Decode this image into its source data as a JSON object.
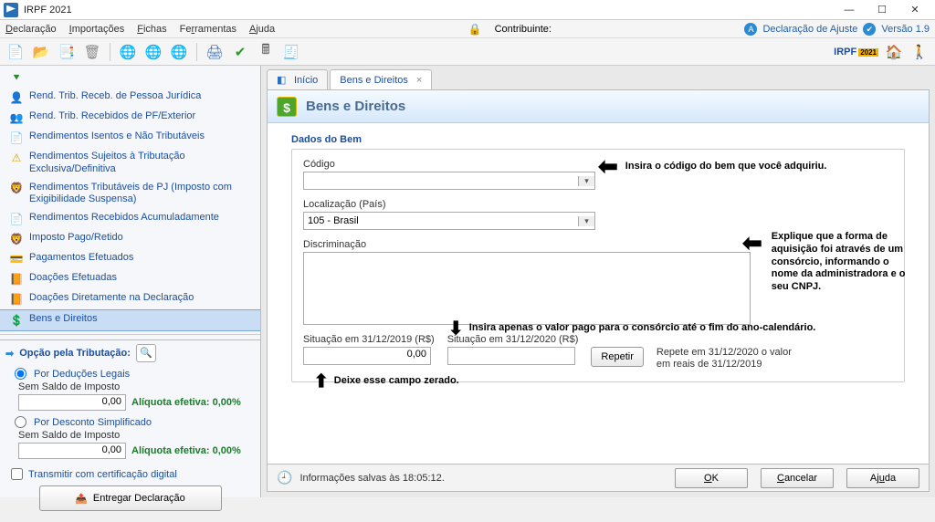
{
  "title": "IRPF 2021",
  "menu": {
    "items": [
      "Declaração",
      "Importações",
      "Fichas",
      "Ferramentas",
      "Ajuda"
    ],
    "contribuinte_label": "Contribuinte:",
    "decl_ajuste": "Declaração de Ajuste",
    "versao": "Versão 1.9"
  },
  "sidebar": {
    "items": [
      "Rend. Trib. Receb. de Pessoa Jurídica",
      "Rend. Trib. Recebidos de PF/Exterior",
      "Rendimentos Isentos e Não Tributáveis",
      "Rendimentos Sujeitos à Tributação Exclusiva/Definitiva",
      "Rendimentos Tributáveis de PJ (Imposto com Exigibilidade Suspensa)",
      "Rendimentos Recebidos Acumuladamente",
      "Imposto Pago/Retido",
      "Pagamentos Efetuados",
      "Doações Efetuadas",
      "Doações Diretamente na Declaração",
      "Bens e Direitos"
    ],
    "opcao_title": "Opção pela Tributação:",
    "opt1": "Por Deduções Legais",
    "opt1_sub": "Sem Saldo de Imposto",
    "opt1_val": "0,00",
    "opt1_eff": "Alíquota efetiva: 0,00%",
    "opt2": "Por Desconto Simplificado",
    "opt2_sub": "Sem Saldo de Imposto",
    "opt2_val": "0,00",
    "opt2_eff": "Alíquota efetiva: 0,00%",
    "transmitir": "Transmitir com certificação digital",
    "entregar": "Entregar Declaração"
  },
  "tabs": {
    "inicio": "Início",
    "bens": "Bens e Direitos"
  },
  "panel": {
    "title": "Bens e Direitos",
    "fieldset": "Dados do Bem",
    "codigo_label": "Código",
    "loc_label": "Localização (País)",
    "loc_value": "105 - Brasil",
    "disc_label": "Discriminação",
    "sit2019_label": "Situação em 31/12/2019 (R$)",
    "sit2019_val": "0,00",
    "sit2020_label": "Situação em 31/12/2020 (R$)",
    "sit2020_val": "",
    "repetir": "Repetir",
    "repetir_hint1": "Repete em 31/12/2020 o valor",
    "repetir_hint2": "em reais de 31/12/2019"
  },
  "annotations": {
    "a1": "Insira o código do bem que você adquiriu.",
    "a2": "Explique que a forma de aquisição foi através de um consórcio, informando o nome da administradora e o seu CNPJ.",
    "a3": "Insira apenas o valor pago para o consórcio até o fim do ano-calendário.",
    "a4": "Deixe esse campo zerado."
  },
  "bottom": {
    "msg": "Informações salvas às 18:05:12.",
    "ok": "OK",
    "cancel": "Cancelar",
    "help": "Ajuda"
  }
}
